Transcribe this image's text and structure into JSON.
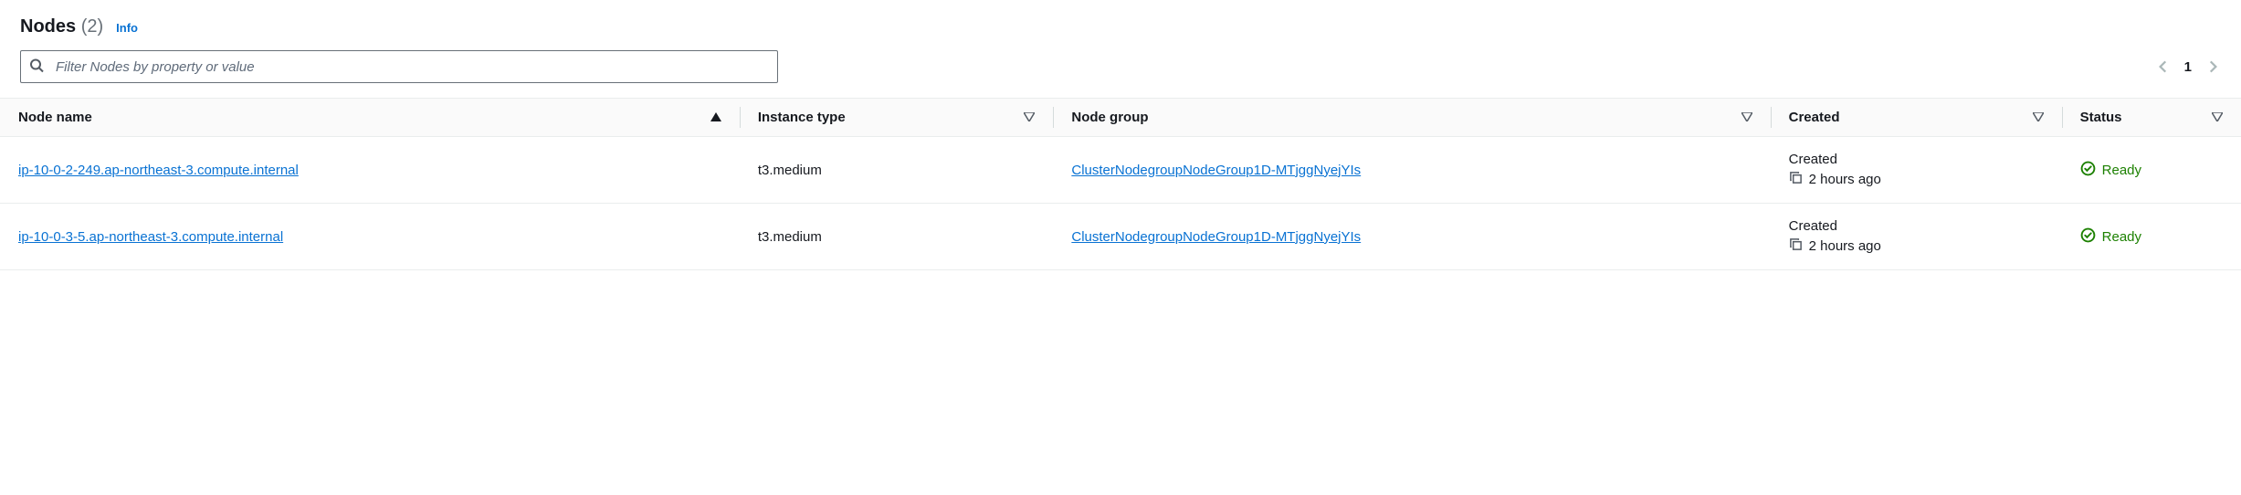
{
  "header": {
    "title": "Nodes",
    "count": "(2)",
    "info": "Info"
  },
  "filter": {
    "placeholder": "Filter Nodes by property or value"
  },
  "pagination": {
    "current": "1"
  },
  "columns": {
    "name": "Node name",
    "instance": "Instance type",
    "group": "Node group",
    "created": "Created",
    "status": "Status"
  },
  "rows": [
    {
      "name": "ip-10-0-2-249.ap-northeast-3.compute.internal",
      "instance": "t3.medium",
      "group": "ClusterNodegroupNodeGroup1D-MTjggNyejYIs",
      "created_label": "Created",
      "created_time": "2 hours ago",
      "status": "Ready"
    },
    {
      "name": "ip-10-0-3-5.ap-northeast-3.compute.internal",
      "instance": "t3.medium",
      "group": "ClusterNodegroupNodeGroup1D-MTjggNyejYIs",
      "created_label": "Created",
      "created_time": "2 hours ago",
      "status": "Ready"
    }
  ]
}
